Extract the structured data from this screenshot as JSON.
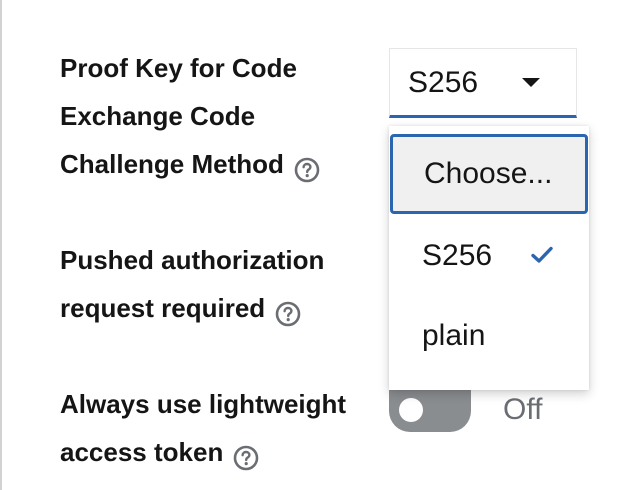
{
  "form": {
    "pkce": {
      "label_lines": [
        "Proof Key for Code",
        "Exchange Code",
        "Challenge Method"
      ],
      "select_value": "S256",
      "menu": {
        "options": [
          "Choose...",
          "S256",
          "plain"
        ],
        "focused_option": "Choose...",
        "selected_option": "S256"
      }
    },
    "par": {
      "label_lines": [
        "Pushed authorization",
        "request required"
      ]
    },
    "lightweight": {
      "label_lines": [
        "Always use lightweight",
        "access token"
      ],
      "toggle_label": "Off",
      "toggle_on": false
    }
  },
  "icons": {
    "help": "help-circle-icon",
    "caret": "caret-down-icon",
    "check": "check-icon"
  },
  "colors": {
    "accent": "#2b65b1",
    "label_text": "#151515",
    "muted_text": "#6a6e73",
    "toggle_off": "#8a8d90",
    "menu_focus_bg": "#f0f0f0",
    "divider": "#d2d2d2"
  }
}
